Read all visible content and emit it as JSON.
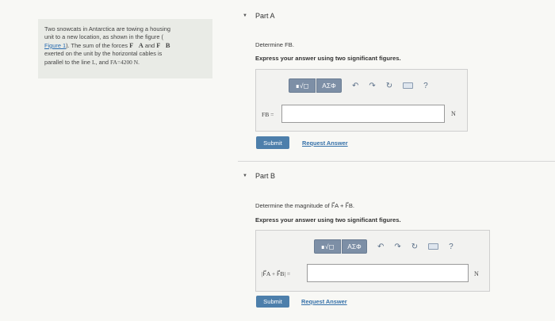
{
  "problem": {
    "line1": "Two snowcats in Antarctica are towing a housing",
    "line2": "unit to a new location, as shown in the figure (",
    "figure_link": "Figure 1",
    "line3_after_link": "). The sum of the forces ",
    "fa": "F⃗A",
    "and": " and ",
    "fb": "F⃗B",
    "line4": "exerted on the unit by the horizontal cables is",
    "line5_a": "parallel to the line ",
    "line_name": "L",
    "line5_b": ", and ",
    "fa_scalar": "FA",
    "fa_value": "=4200 N",
    "line5_end": "."
  },
  "partA": {
    "header": "Part A",
    "prompt": "Determine FB.",
    "instruction": "Express your answer using two significant figures.",
    "toolbar": {
      "templates_label": "∎√◻",
      "greek_label": "AΣΦ",
      "help_label": "?"
    },
    "input_label": "FB =",
    "input_value": "",
    "unit": "N",
    "submit_label": "Submit",
    "request_label": "Request Answer"
  },
  "partB": {
    "header": "Part B",
    "prompt": "Determine the magnitude of F⃗A + F⃗B.",
    "instruction": "Express your answer using two significant figures.",
    "toolbar": {
      "templates_label": "∎√◻",
      "greek_label": "AΣΦ",
      "help_label": "?"
    },
    "input_label": "|F⃗A + F⃗B| =",
    "input_value": "",
    "unit": "N",
    "submit_label": "Submit",
    "request_label": "Request Answer"
  },
  "icons": {
    "undo": "undo-icon",
    "redo": "redo-icon",
    "reset": "reset-icon",
    "keyboard": "keyboard-icon",
    "collapse": "collapse-triangle-icon"
  },
  "colors": {
    "accent": "#4d7fab",
    "link": "#3470a8",
    "toolbar": "#7d8fa6"
  }
}
